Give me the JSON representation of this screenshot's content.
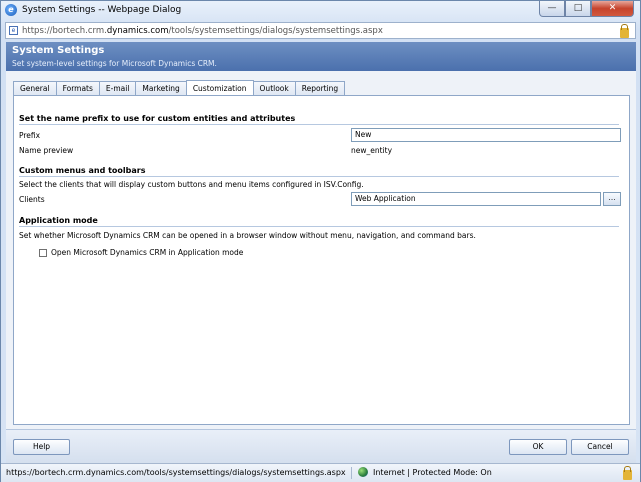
{
  "window": {
    "title": "System Settings -- Webpage Dialog",
    "app_icon": "ie-icon",
    "buttons": {
      "minimize": "—",
      "maximize": "□",
      "close": "✕"
    }
  },
  "address_bar": {
    "url_prefix": "https://bortech.crm.",
    "url_host": "dynamics.com",
    "url_path": "/tools/systemsettings/dialogs/systemsettings.aspx"
  },
  "header": {
    "title": "System Settings",
    "subtitle": "Set system-level settings for Microsoft Dynamics CRM."
  },
  "tabs": [
    {
      "label": "General"
    },
    {
      "label": "Formats"
    },
    {
      "label": "E-mail"
    },
    {
      "label": "Marketing"
    },
    {
      "label": "Customization",
      "active": true
    },
    {
      "label": "Outlook"
    },
    {
      "label": "Reporting"
    }
  ],
  "customization": {
    "prefix_section": {
      "heading": "Set the name prefix to use for custom entities and attributes",
      "prefix_label": "Prefix",
      "prefix_value": "New",
      "preview_label": "Name preview",
      "preview_value": "new_entity"
    },
    "menus_section": {
      "heading": "Custom menus and toolbars",
      "description": "Select the clients that will display custom buttons and menu items configured in ISV.Config.",
      "clients_label": "Clients",
      "clients_value": "Web Application",
      "lookup_label": "..."
    },
    "app_mode_section": {
      "heading": "Application mode",
      "description": "Set whether Microsoft Dynamics CRM can be opened in a browser window without menu, navigation, and command bars.",
      "checkbox_label": "Open Microsoft Dynamics CRM in Application mode",
      "checked": false
    }
  },
  "footer": {
    "help_label": "Help",
    "ok_label": "OK",
    "cancel_label": "Cancel"
  },
  "status_bar": {
    "url": "https://bortech.crm.dynamics.com/tools/systemsettings/dialogs/systemsettings.aspx",
    "zone": "Internet | Protected Mode: On"
  }
}
